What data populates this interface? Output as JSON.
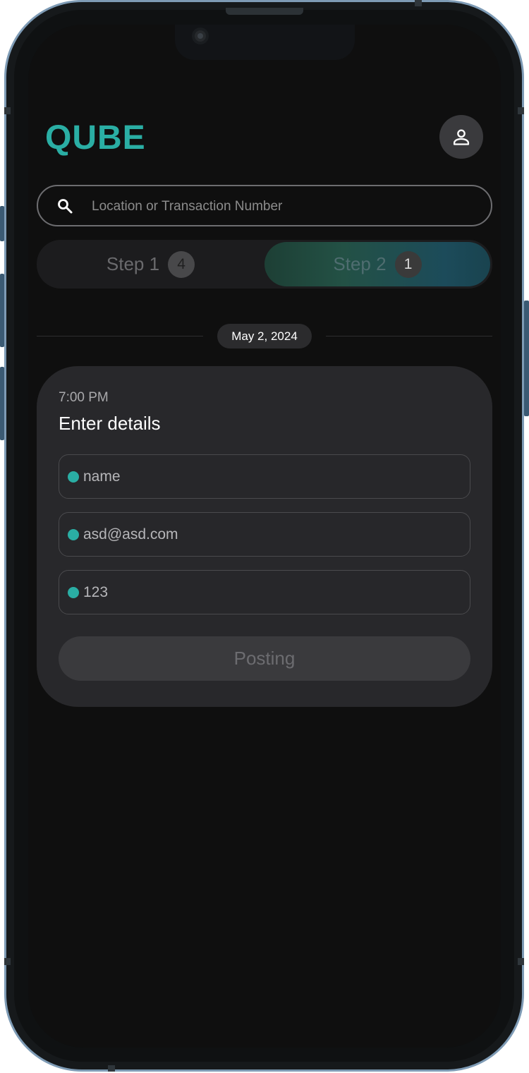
{
  "app": {
    "logo_text": "QUBE",
    "brand_color": "#2aaea4"
  },
  "search": {
    "placeholder": "Location or Transaction Number",
    "value": ""
  },
  "steps": [
    {
      "label": "Step 1",
      "count": "4",
      "active": false
    },
    {
      "label": "Step 2",
      "count": "1",
      "active": true
    }
  ],
  "date_separator": "May 2, 2024",
  "card": {
    "time": "7:00 PM",
    "title": "Enter details",
    "fields": [
      {
        "value": "name"
      },
      {
        "value": "asd@asd.com"
      },
      {
        "value": "123"
      }
    ],
    "submit_label": "Posting"
  },
  "icons": {
    "search": "search-icon",
    "profile": "user-icon"
  }
}
